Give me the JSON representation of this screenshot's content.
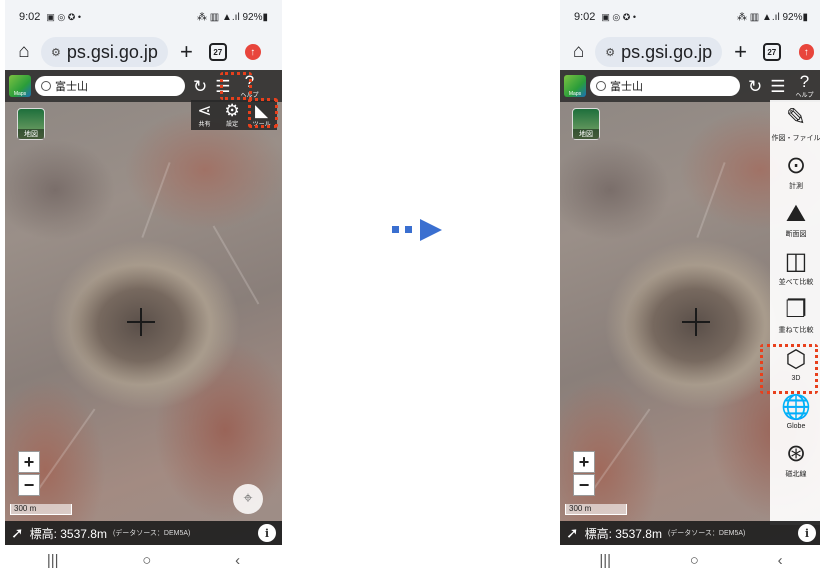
{
  "status": {
    "time": "9:02",
    "right": "92%"
  },
  "browser": {
    "url": "ps.gsi.go.jp",
    "tab_count": "27"
  },
  "search": {
    "query": "富士山"
  },
  "logo_text": "Maps",
  "layer": {
    "label": "地図"
  },
  "toolbar": {
    "help_label": "ヘルプ",
    "share_label": "共有",
    "settings_label": "設定",
    "tools_label": "ツール"
  },
  "map": {
    "zoom_in": "+",
    "zoom_out": "−",
    "scale": "300 m"
  },
  "elevation": {
    "label": "標高: 3537.8m",
    "source": "(データソース：DEM5A)",
    "info": "i"
  },
  "side_tools": [
    {
      "label": "作図・ファイル",
      "icon": "pencil-icon"
    },
    {
      "label": "計測",
      "icon": "measure-icon"
    },
    {
      "label": "断面図",
      "icon": "profile-icon"
    },
    {
      "label": "並べて比較",
      "icon": "split-compare-icon"
    },
    {
      "label": "重ねて比較",
      "icon": "overlay-compare-icon"
    },
    {
      "label": "3D",
      "icon": "cube-icon"
    },
    {
      "label": "Globe",
      "icon": "globe-icon"
    },
    {
      "label": "磁北線",
      "icon": "compass-icon"
    }
  ],
  "colors": {
    "highlight": "#e8401c",
    "arrow": "#3a6fd0"
  }
}
